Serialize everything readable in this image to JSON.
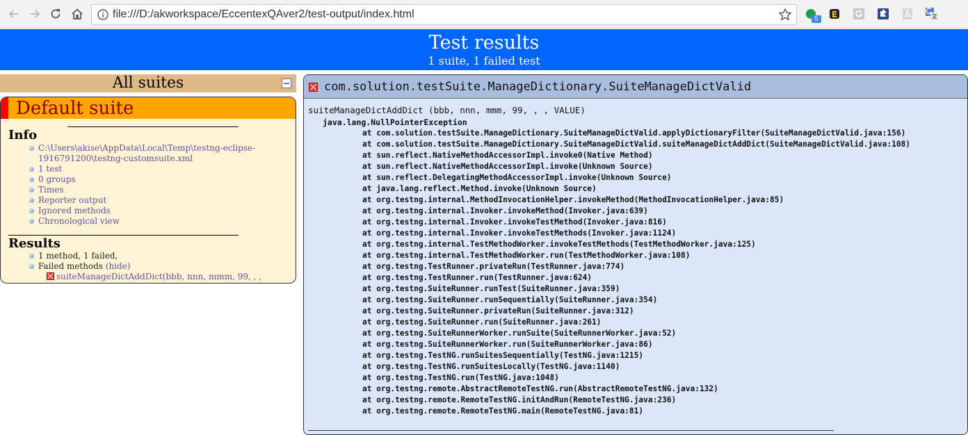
{
  "browser": {
    "url": "file:///D:/akworkspace/EccentexQAver2/test-output/index.html",
    "extension_badge": "5",
    "icons": [
      "back-arrow-icon",
      "forward-arrow-icon",
      "reload-icon",
      "home-icon",
      "info-icon",
      "star-icon"
    ]
  },
  "banner": {
    "title": "Test results",
    "subtitle": "1 suite, 1 failed test"
  },
  "sidebar": {
    "header": "All suites",
    "suite_name": "Default suite",
    "info_title": "Info",
    "info_items": [
      "C:\\Users\\akise\\AppData\\Local\\Temp\\testng-eclipse-",
      "1916791200\\testng-customsuite.xml",
      "1 test",
      "0 groups",
      "Times",
      "Reporter output",
      "Ignored methods",
      "Chronological view"
    ],
    "results_title": "Results",
    "results_summary": "1 method, 1 failed,",
    "failed_methods_label": "Failed methods",
    "hide_label": "(hide)",
    "failed_method": "suiteManageDictAddDict(bbb, nnn, mmm, 99, , , VALUE)"
  },
  "detail": {
    "title": "com.solution.testSuite.ManageDictionary.SuiteManageDictValid",
    "method_name": "suiteManageDictAddDict",
    "method_params": " (bbb, nnn, mmm, 99, , , VALUE)",
    "exception": "java.lang.NullPointerException",
    "stack_trace": [
      "at com.solution.testSuite.ManageDictionary.SuiteManageDictValid.applyDictionaryFilter(SuiteManageDictValid.java:156)",
      "at com.solution.testSuite.ManageDictionary.SuiteManageDictValid.suiteManageDictAddDict(SuiteManageDictValid.java:108)",
      "at sun.reflect.NativeMethodAccessorImpl.invoke0(Native Method)",
      "at sun.reflect.NativeMethodAccessorImpl.invoke(Unknown Source)",
      "at sun.reflect.DelegatingMethodAccessorImpl.invoke(Unknown Source)",
      "at java.lang.reflect.Method.invoke(Unknown Source)",
      "at org.testng.internal.MethodInvocationHelper.invokeMethod(MethodInvocationHelper.java:85)",
      "at org.testng.internal.Invoker.invokeMethod(Invoker.java:639)",
      "at org.testng.internal.Invoker.invokeTestMethod(Invoker.java:816)",
      "at org.testng.internal.Invoker.invokeTestMethods(Invoker.java:1124)",
      "at org.testng.internal.TestMethodWorker.invokeTestMethods(TestMethodWorker.java:125)",
      "at org.testng.internal.TestMethodWorker.run(TestMethodWorker.java:108)",
      "at org.testng.TestRunner.privateRun(TestRunner.java:774)",
      "at org.testng.TestRunner.run(TestRunner.java:624)",
      "at org.testng.SuiteRunner.runTest(SuiteRunner.java:359)",
      "at org.testng.SuiteRunner.runSequentially(SuiteRunner.java:354)",
      "at org.testng.SuiteRunner.privateRun(SuiteRunner.java:312)",
      "at org.testng.SuiteRunner.run(SuiteRunner.java:261)",
      "at org.testng.SuiteRunnerWorker.runSuite(SuiteRunnerWorker.java:52)",
      "at org.testng.SuiteRunnerWorker.run(SuiteRunnerWorker.java:86)",
      "at org.testng.TestNG.runSuitesSequentially(TestNG.java:1215)",
      "at org.testng.TestNG.runSuitesLocally(TestNG.java:1140)",
      "at org.testng.TestNG.run(TestNG.java:1048)",
      "at org.testng.remote.AbstractRemoteTestNG.run(AbstractRemoteTestNG.java:132)",
      "at org.testng.remote.RemoteTestNG.initAndRun(RemoteTestNG.java:236)",
      "at org.testng.remote.RemoteTestNG.main(RemoteTestNG.java:81)"
    ]
  },
  "colors": {
    "banner": "#0066ff",
    "suite_header": "#ffa500",
    "suite_name": "#8b0000",
    "all_suites_bar": "#deb887",
    "suite_body": "#fff5d6",
    "detail_body": "#dbe6f8",
    "detail_header": "#a8bde0",
    "link": "#6b4b9b"
  }
}
